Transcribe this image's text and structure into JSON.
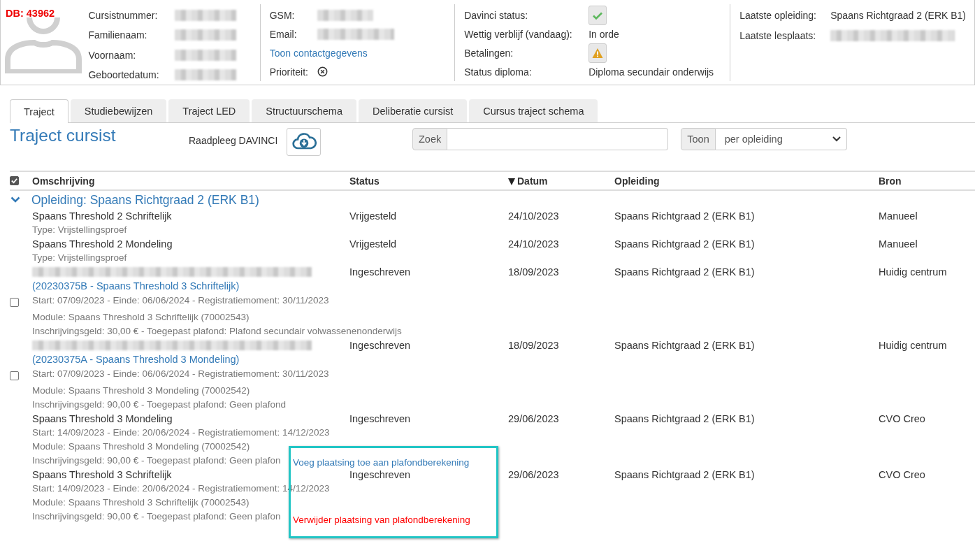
{
  "record_label": "DB: 43962",
  "profile": [
    {
      "fields": [
        {
          "kind": "redacted",
          "label": "Cursistnummer:"
        },
        {
          "kind": "redacted",
          "label": "Familienaam:"
        },
        {
          "kind": "redacted",
          "label": "Voornaam:"
        },
        {
          "kind": "redacted",
          "label": "Geboortedatum:"
        }
      ]
    },
    {
      "fields": [
        {
          "kind": "redacted",
          "label": "GSM:"
        },
        {
          "kind": "redacted",
          "label": "Email:",
          "link": true
        },
        {
          "kind": "link",
          "label": "Toon contactgegevens"
        },
        {
          "kind": "cancel",
          "label": "Prioriteit:"
        }
      ]
    },
    {
      "fields": [
        {
          "kind": "check",
          "label": "Davinci status:"
        },
        {
          "kind": "text",
          "label": "Wettig verblijf (vandaag):",
          "value": "In orde"
        },
        {
          "kind": "warning",
          "label": "Betalingen:"
        },
        {
          "kind": "text",
          "label": "Status diploma:",
          "value": "Diploma secundair onderwijs"
        }
      ]
    },
    {
      "fields": [
        {
          "kind": "text",
          "label": "Laatste opleiding:",
          "value": "Spaans Richtgraad 2 (ERK B1)"
        },
        {
          "kind": "redacted",
          "label": "Laatste lesplaats:"
        }
      ]
    }
  ],
  "tabs": [
    {
      "label": "Traject",
      "selected": true
    },
    {
      "label": "Studiebewijzen",
      "selected": false
    },
    {
      "label": "Traject LED",
      "selected": false
    },
    {
      "label": "Structuurschema",
      "selected": false
    },
    {
      "label": "Deliberatie cursist",
      "selected": false
    },
    {
      "label": "Cursus traject schema",
      "selected": false
    }
  ],
  "toolbar": {
    "title": "Traject cursist",
    "davinci_label": "Raadpleeg DAVINCI",
    "search": {
      "label": "Zoek"
    },
    "view": {
      "label": "Toon",
      "value": "per opleiding"
    }
  },
  "table": {
    "select_all": {
      "checked": true
    },
    "columns": [
      {
        "label": "Omschrijving",
        "sorted": false
      },
      {
        "label": "Status",
        "sorted": false
      },
      {
        "label": "Datum",
        "sorted": true
      },
      {
        "label": "Opleiding",
        "sorted": false
      },
      {
        "label": "Bron",
        "sorted": false
      }
    ],
    "groups": [
      {
        "label": "Opleiding: Spaans Richtgraad 2 (ERK B1)",
        "expanded": true,
        "rows": [
          {
            "kind": "exemption",
            "title": "Spaans Threshold 2 Schriftelijk",
            "details": [
              "Type: Vrijstellingsproef"
            ],
            "status": "Vrijgesteld",
            "date": "24/10/2023",
            "programme": "Spaans Richtgraad 2 (ERK B1)",
            "source": "Manueel"
          },
          {
            "kind": "exemption",
            "title": "Spaans Threshold 2 Mondeling",
            "details": [
              "Type: Vrijstellingsproef"
            ],
            "status": "Vrijgesteld",
            "date": "24/10/2023",
            "programme": "Spaans Richtgraad 2 (ERK B1)",
            "source": "Manueel"
          },
          {
            "kind": "enrollment",
            "code": "(20230375B - Spaans Threshold 3 Schriftelijk)",
            "checked": false,
            "period": "Start: 07/09/2023 - Einde: 06/06/2024 - Registratiemoment: 30/11/2023",
            "details": [
              "Module: Spaans Threshold 3 Schriftelijk (70002543)",
              "Inschrijvingsgeld: 30,00 € - Toegepast plafond: Plafond secundair volwassenenonderwijs"
            ],
            "status": "Ingeschreven",
            "date": "18/09/2023",
            "programme": "Spaans Richtgraad 2 (ERK B1)",
            "source": "Huidig centrum"
          },
          {
            "kind": "enrollment",
            "code": "(20230375A - Spaans Threshold 3 Mondeling)",
            "checked": false,
            "period": "Start: 07/09/2023 - Einde: 06/06/2024 - Registratiemoment: 30/11/2023",
            "details": [
              "Module: Spaans Threshold 3 Mondeling (70002542)",
              "Inschrijvingsgeld: 90,00 € - Toegepast plafond: Geen plafond"
            ],
            "status": "Ingeschreven",
            "date": "18/09/2023",
            "programme": "Spaans Richtgraad 2 (ERK B1)",
            "source": "Huidig centrum"
          },
          {
            "kind": "placement",
            "title": "Spaans Threshold 3 Mondeling",
            "details": [
              "Start: 14/09/2023 - Einde: 20/06/2024 - Registratiemoment: 14/12/2023",
              "Module: Spaans Threshold 3 Mondeling (70002542)",
              "Inschrijvingsgeld: 90,00 € - Toegepast plafond: Geen plafon"
            ],
            "status": "Ingeschreven",
            "date": "29/06/2023",
            "programme": "Spaans Richtgraad 2 (ERK B1)",
            "source": "CVO Creo"
          },
          {
            "kind": "placement",
            "title": "Spaans Threshold 3 Schriftelijk",
            "details": [
              "Start: 14/09/2023 - Einde: 20/06/2024 - Registratiemoment: 14/12/2023",
              "Module: Spaans Threshold 3 Schriftelijk (70002543)",
              "Inschrijvingsgeld: 90,00 € - Toegepast plafond: Geen plafon"
            ],
            "status": "Ingeschreven",
            "date": "29/06/2023",
            "programme": "Spaans Richtgraad 2 (ERK B1)",
            "source": "CVO Creo"
          }
        ]
      }
    ]
  },
  "popup": {
    "items": [
      {
        "kind": "add",
        "label": "Voeg plaatsing toe aan plafondberekening"
      },
      {
        "kind": "remove",
        "label": "Verwijder plaatsing van plafondberekening"
      }
    ]
  }
}
